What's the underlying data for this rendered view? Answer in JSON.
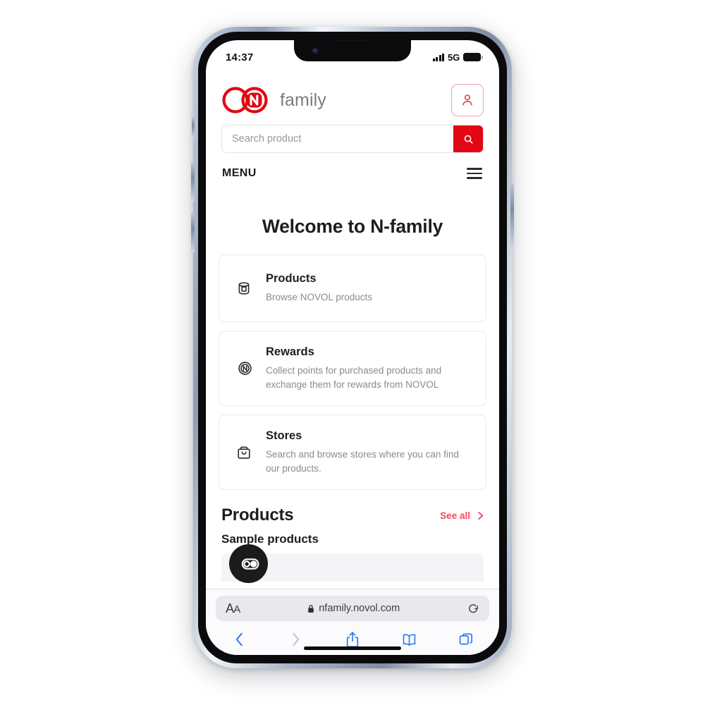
{
  "status_bar": {
    "time": "14:37",
    "network": "5G",
    "signal_icon": "cellular-bars-icon",
    "battery_icon": "battery-full-icon"
  },
  "header": {
    "logo_icon": "n-family-logo-icon",
    "brand_word": "family",
    "account_icon": "user-account-icon"
  },
  "search": {
    "placeholder": "Search product",
    "value": "",
    "button_icon": "search-icon",
    "accent": "#e30613"
  },
  "menu": {
    "label": "MENU",
    "icon": "hamburger-menu-icon"
  },
  "main": {
    "welcome_title": "Welcome to N-family",
    "cards": [
      {
        "icon": "paint-can-icon",
        "title": "Products",
        "description": "Browse NOVOL products"
      },
      {
        "icon": "reward-coin-icon",
        "title": "Rewards",
        "description": "Collect points for purchased products and exchange them for rewards from NOVOL"
      },
      {
        "icon": "shopping-bag-icon",
        "title": "Stores",
        "description": "Search and browse stores where you can find our products."
      }
    ],
    "products_section": {
      "title": "Products",
      "see_all_label": "See all",
      "see_all_icon": "chevron-right-icon",
      "subtitle": "Sample products"
    }
  },
  "cookie_widget": {
    "icon": "cookiebot-consent-icon",
    "badge_text": "co"
  },
  "browser": {
    "text_size_label": "AA",
    "lock_icon": "lock-icon",
    "url": "nfamily.novol.com",
    "reload_icon": "reload-icon",
    "toolbar": [
      {
        "icon": "back-arrow-icon",
        "enabled": true
      },
      {
        "icon": "forward-arrow-icon",
        "enabled": false
      },
      {
        "icon": "share-icon",
        "enabled": true
      },
      {
        "icon": "bookmarks-icon",
        "enabled": true
      },
      {
        "icon": "tabs-icon",
        "enabled": true
      }
    ],
    "accent": "#2f7cf6"
  }
}
